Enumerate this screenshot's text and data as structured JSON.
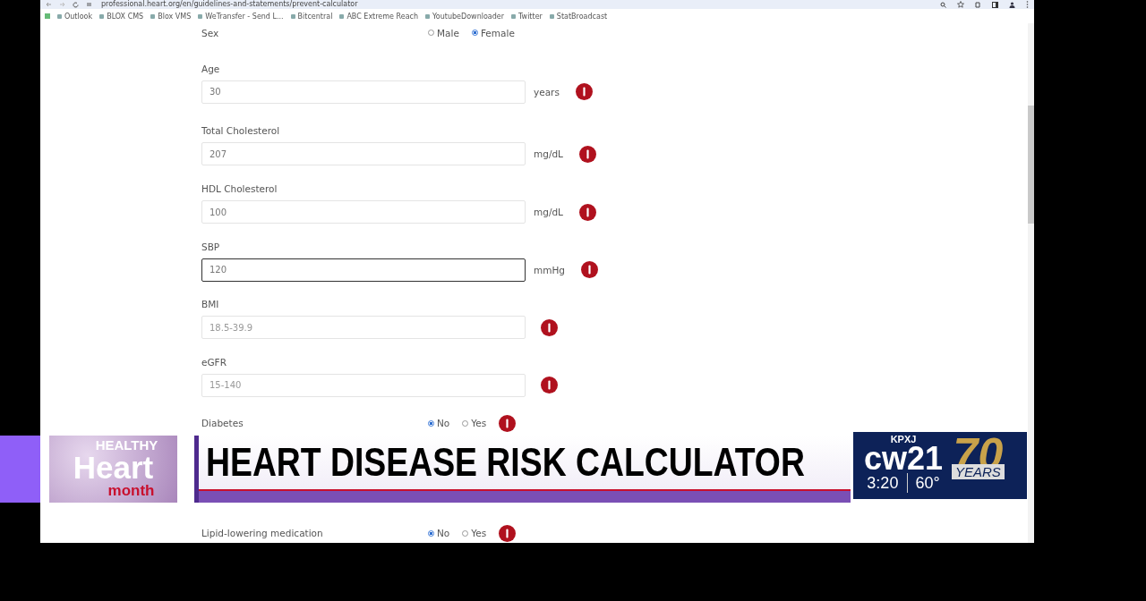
{
  "browser": {
    "url": "professional.heart.org/en/guidelines-and-statements/prevent-calculator",
    "bookmarks": [
      "Outlook",
      "BLOX CMS",
      "Blox VMS",
      "WeTransfer - Send L...",
      "Bitcentral",
      "ABC Extreme Reach",
      "YoutubeDownloader",
      "Twitter",
      "StatBroadcast"
    ]
  },
  "form": {
    "fields": [
      {
        "kind": "radio",
        "label": "Sex",
        "info": false,
        "options": [
          {
            "label": "Male",
            "selected": false
          },
          {
            "label": "Female",
            "selected": true
          }
        ]
      },
      {
        "kind": "number",
        "label": "Age",
        "value": "30",
        "unit": "years",
        "focused": false,
        "info": true
      },
      {
        "kind": "number",
        "label": "Total Cholesterol",
        "value": "207",
        "unit": "mg/dL",
        "focused": false,
        "info": true
      },
      {
        "kind": "number",
        "label": "HDL Cholesterol",
        "value": "100",
        "unit": "mg/dL",
        "focused": false,
        "info": true
      },
      {
        "kind": "number",
        "label": "SBP",
        "value": "120",
        "unit": "mmHg",
        "focused": true,
        "info": true
      },
      {
        "kind": "number",
        "label": "BMI",
        "placeholder": "18.5-39.9",
        "focused": false,
        "info": true
      },
      {
        "kind": "number",
        "label": "eGFR",
        "placeholder": "15-140",
        "focused": false,
        "info": true
      },
      {
        "kind": "radio",
        "label": "Diabetes",
        "info": true,
        "options": [
          {
            "label": "No",
            "selected": true
          },
          {
            "label": "Yes",
            "selected": false
          }
        ]
      },
      {
        "kind": "radio",
        "label": "Lipid-lowering medication",
        "info": true,
        "options": [
          {
            "label": "No",
            "selected": true
          },
          {
            "label": "Yes",
            "selected": false
          }
        ]
      }
    ]
  },
  "lower_third": {
    "logo": {
      "line_1": "HEALTHY",
      "line_2": "Heart",
      "line_3": "month"
    },
    "headline": "HEART DISEASE RISK CALCULATOR",
    "station": {
      "call_sign": "KPXJ",
      "brand": "cw21",
      "anniversary": "70",
      "anniversary_label": "YEARS",
      "time": "3:20",
      "temperature": "60°"
    }
  }
}
